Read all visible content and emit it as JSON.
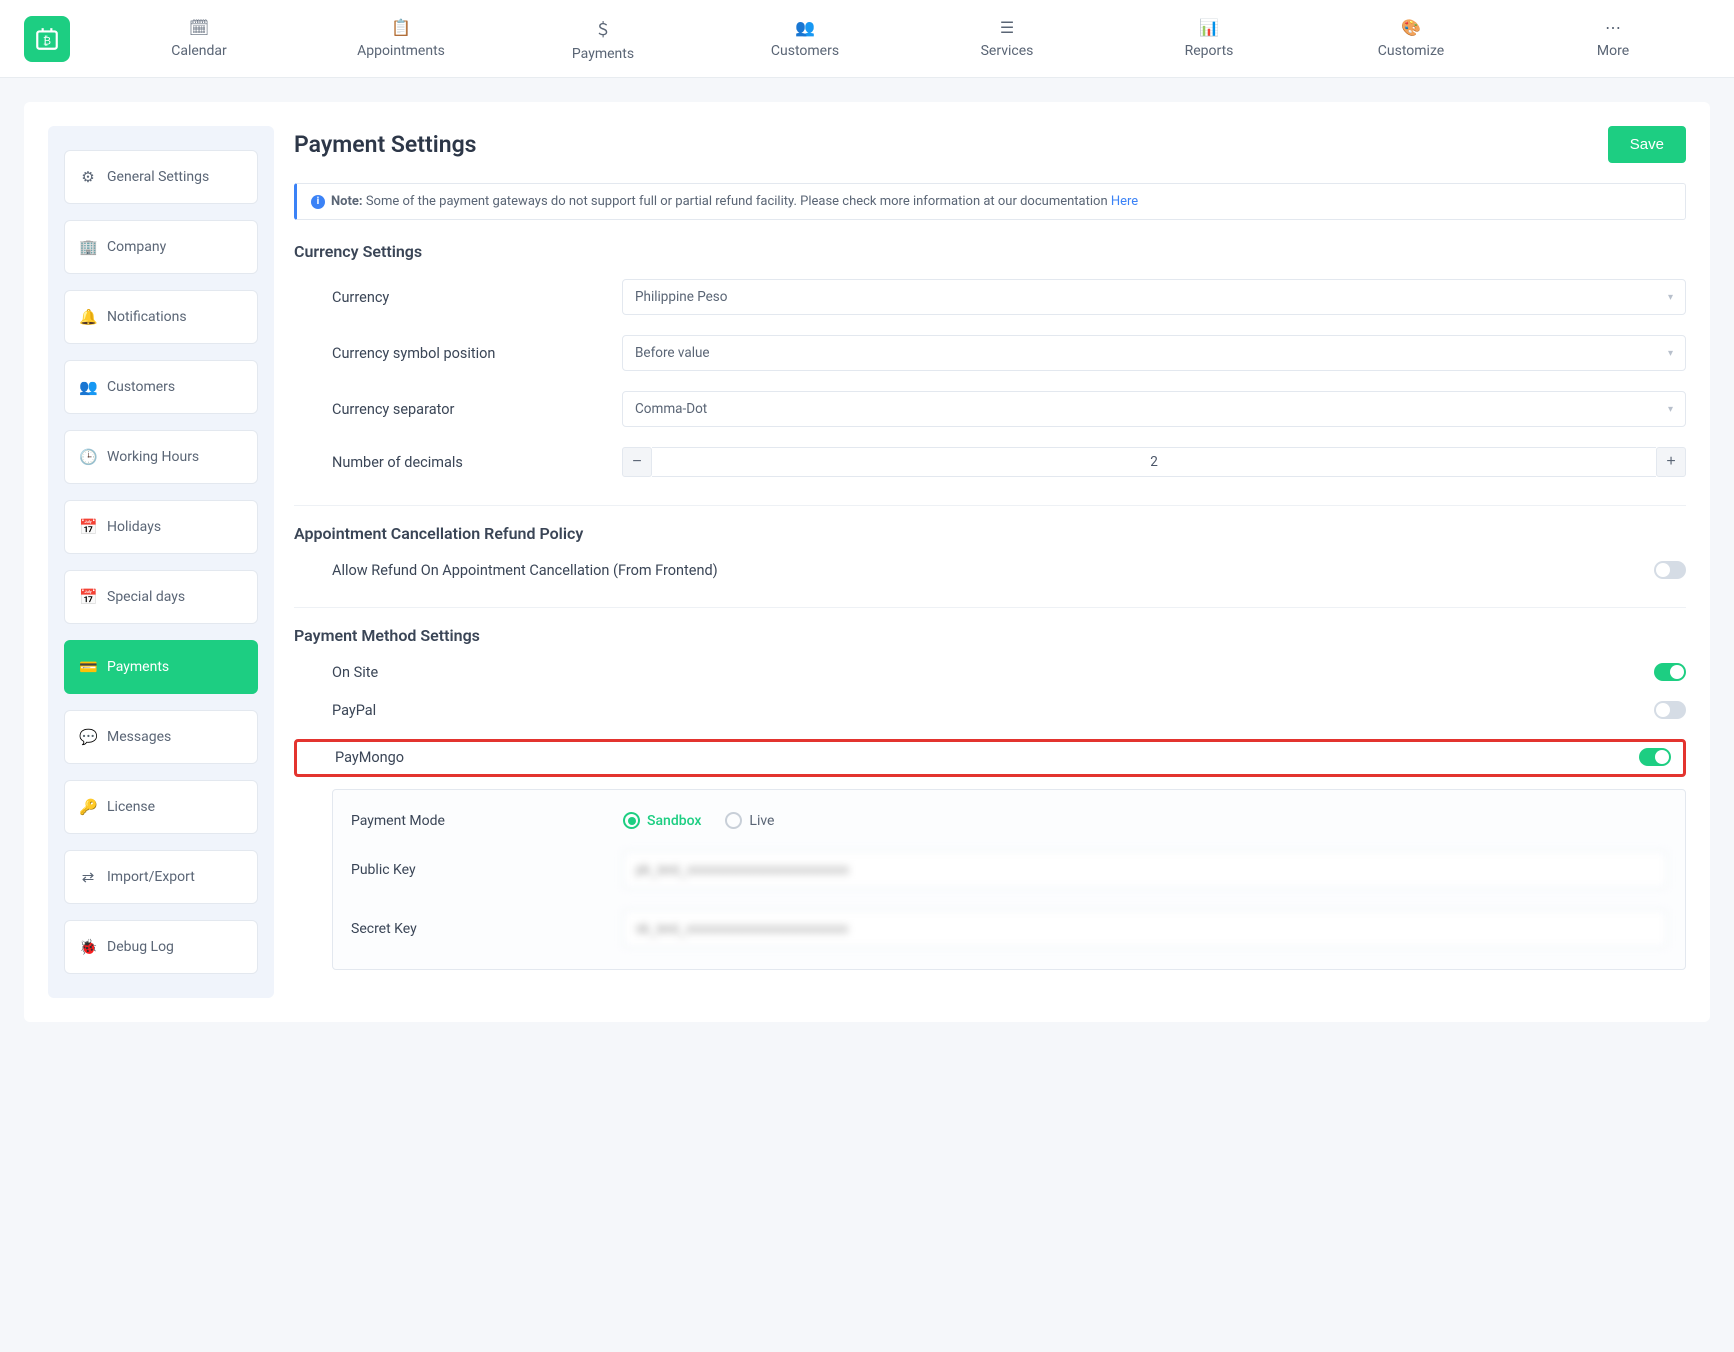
{
  "topnav": [
    {
      "icon": "calendar",
      "label": "Calendar"
    },
    {
      "icon": "event",
      "label": "Appointments"
    },
    {
      "icon": "dollar",
      "label": "Payments"
    },
    {
      "icon": "users",
      "label": "Customers"
    },
    {
      "icon": "services",
      "label": "Services"
    },
    {
      "icon": "reports",
      "label": "Reports"
    },
    {
      "icon": "customize",
      "label": "Customize"
    },
    {
      "icon": "more",
      "label": "More"
    }
  ],
  "sidebar": [
    {
      "icon": "⚙",
      "label": "General Settings"
    },
    {
      "icon": "🏢",
      "label": "Company"
    },
    {
      "icon": "🔔",
      "label": "Notifications"
    },
    {
      "icon": "👥",
      "label": "Customers"
    },
    {
      "icon": "🕒",
      "label": "Working Hours"
    },
    {
      "icon": "📅",
      "label": "Holidays"
    },
    {
      "icon": "📅",
      "label": "Special days"
    },
    {
      "icon": "💳",
      "label": "Payments",
      "active": true
    },
    {
      "icon": "💬",
      "label": "Messages"
    },
    {
      "icon": "🔑",
      "label": "License"
    },
    {
      "icon": "⇄",
      "label": "Import/Export"
    },
    {
      "icon": "🐞",
      "label": "Debug Log"
    }
  ],
  "pageTitle": "Payment Settings",
  "saveLabel": "Save",
  "note": {
    "prefix": "Note:",
    "text": " Some of the payment gateways do not support full or partial refund facility. Please check more information at our documentation ",
    "link": "Here"
  },
  "sections": {
    "currency": {
      "title": "Currency Settings",
      "fields": {
        "currency": {
          "label": "Currency",
          "value": "Philippine Peso"
        },
        "symbolPos": {
          "label": "Currency symbol position",
          "value": "Before value"
        },
        "separator": {
          "label": "Currency separator",
          "value": "Comma-Dot"
        },
        "decimals": {
          "label": "Number of decimals",
          "value": "2"
        }
      }
    },
    "refund": {
      "title": "Appointment Cancellation Refund Policy",
      "allowRefund": {
        "label": "Allow Refund On Appointment Cancellation (From Frontend)",
        "value": false
      }
    },
    "methods": {
      "title": "Payment Method Settings",
      "onSite": {
        "label": "On Site",
        "value": true
      },
      "paypal": {
        "label": "PayPal",
        "value": false
      },
      "paymongo": {
        "label": "PayMongo",
        "value": true,
        "config": {
          "paymentMode": {
            "label": "Payment Mode",
            "options": [
              "Sandbox",
              "Live"
            ],
            "selected": "Sandbox"
          },
          "publicKey": {
            "label": "Public Key",
            "value": "pk_test_xxxxxxxxxxxxxxxxxxxxxxxx"
          },
          "secretKey": {
            "label": "Secret Key",
            "value": "sk_test_xxxxxxxxxxxxxxxxxxxxxxxx"
          }
        }
      }
    }
  }
}
